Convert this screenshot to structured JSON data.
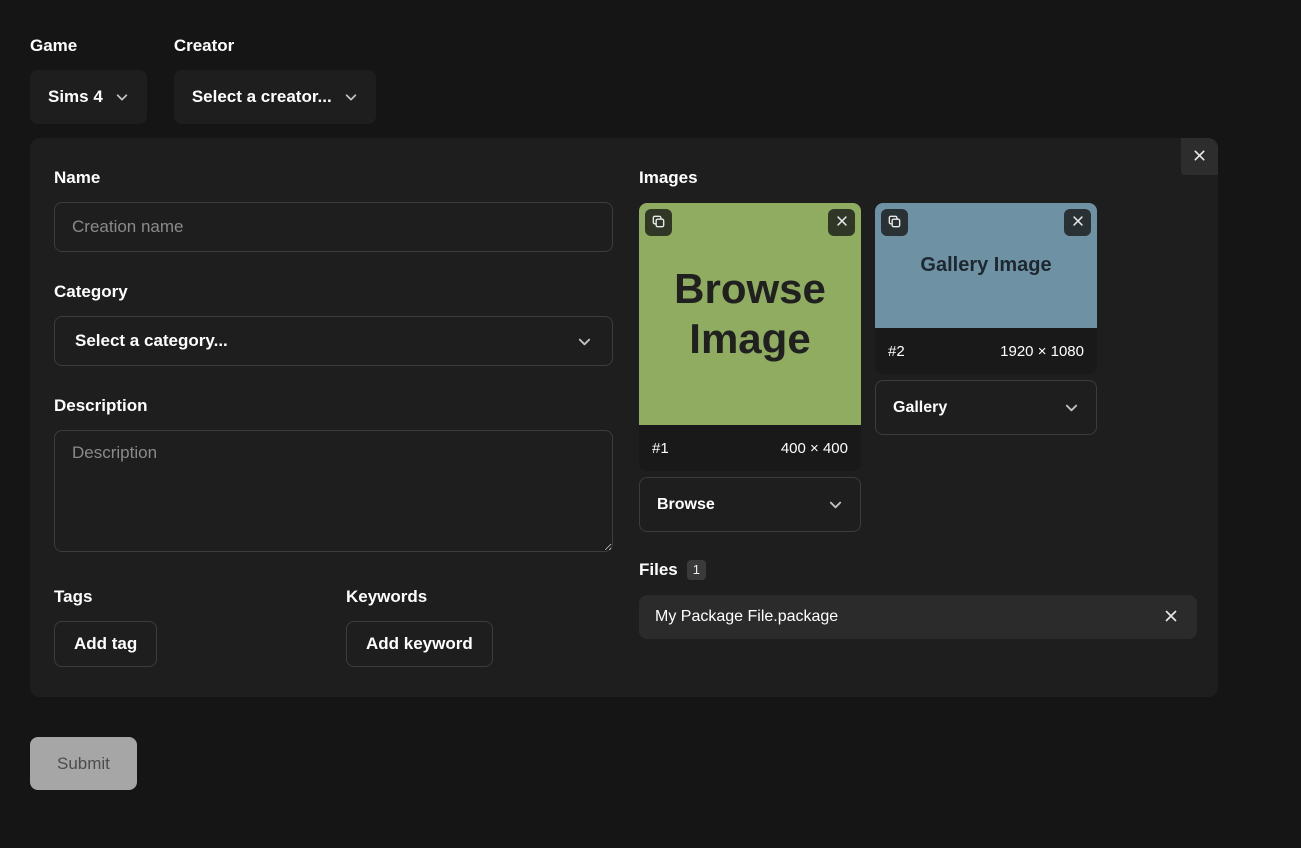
{
  "top": {
    "game_label": "Game",
    "game_value": "Sims 4",
    "creator_label": "Creator",
    "creator_value": "Select a creator..."
  },
  "form": {
    "name_label": "Name",
    "name_placeholder": "Creation name",
    "category_label": "Category",
    "category_value": "Select a category...",
    "description_label": "Description",
    "description_placeholder": "Description",
    "tags_label": "Tags",
    "add_tag": "Add tag",
    "keywords_label": "Keywords",
    "add_keyword": "Add keyword"
  },
  "images": {
    "label": "Images",
    "items": [
      {
        "index": "#1",
        "dimensions": "400 × 400",
        "type": "Browse",
        "preview_text": "Browse Image",
        "preview_color": "#8fac60"
      },
      {
        "index": "#2",
        "dimensions": "1920 × 1080",
        "type": "Gallery",
        "preview_text": "Gallery Image",
        "preview_color": "#6e92a4"
      }
    ]
  },
  "files": {
    "label": "Files",
    "count": "1",
    "items": [
      {
        "name": "My Package File.package"
      }
    ]
  },
  "actions": {
    "submit": "Submit",
    "close": "✕"
  }
}
